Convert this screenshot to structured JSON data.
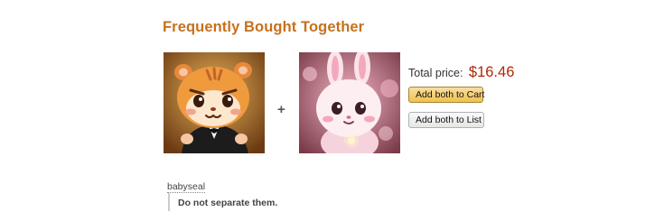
{
  "section": {
    "title": "Frequently Bought Together"
  },
  "products": {
    "separator": "+",
    "items": [
      {
        "icon": "hamster-character-image"
      },
      {
        "icon": "bunny-character-image"
      }
    ]
  },
  "summary": {
    "total_label": "Total price:",
    "total_price": "$16.46",
    "add_cart_label": "Add both to Cart",
    "add_list_label": "Add both to List"
  },
  "post": {
    "username": "babyseal",
    "quote": "Do not separate them."
  },
  "colors": {
    "title": "#c8701b",
    "price": "#b12704",
    "cart_button": "#f0c14b"
  }
}
